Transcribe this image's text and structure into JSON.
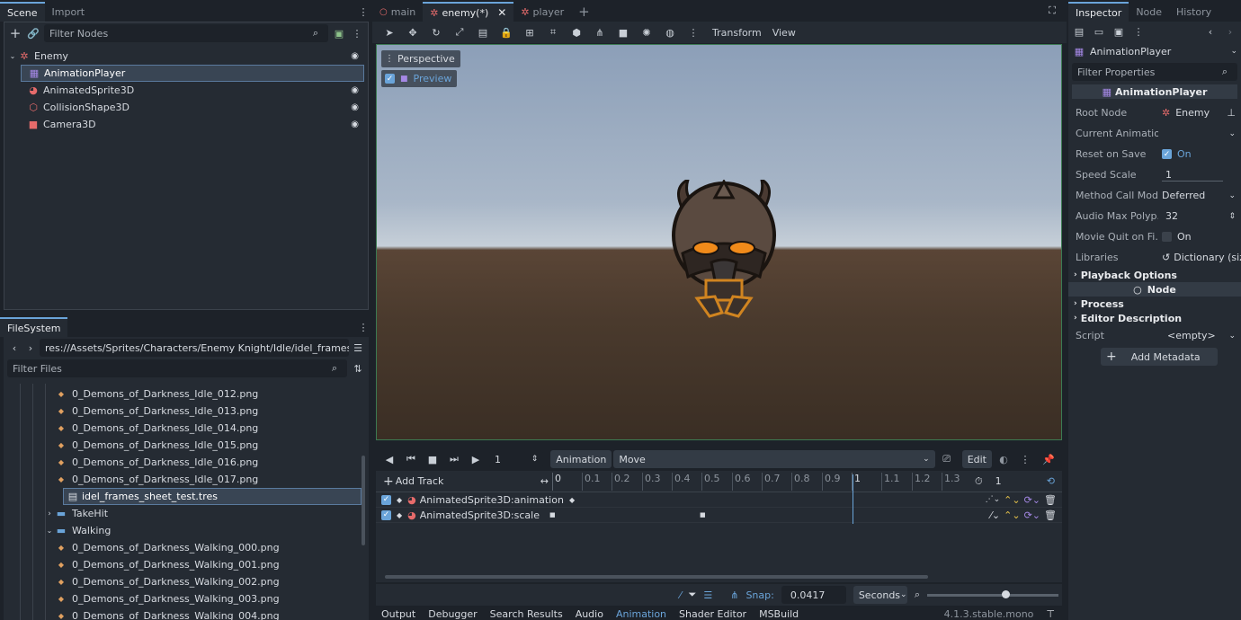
{
  "left_top": {
    "tabs": [
      "Scene",
      "Import"
    ],
    "filter_placeholder": "Filter Nodes",
    "nodes": [
      {
        "label": "Enemy",
        "icon": "node3d-icon"
      },
      {
        "label": "AnimationPlayer",
        "icon": "animation-player-icon"
      },
      {
        "label": "AnimatedSprite3D",
        "icon": "animated-sprite-icon"
      },
      {
        "label": "CollisionShape3D",
        "icon": "collision-shape-icon"
      },
      {
        "label": "Camera3D",
        "icon": "camera-icon"
      }
    ]
  },
  "filesystem": {
    "tab": "FileSystem",
    "path": "res://Assets/Sprites/Characters/Enemy Knight/Idle/idel_frames_sheet_t",
    "filter_placeholder": "Filter Files",
    "items": [
      "0_Demons_of_Darkness_Idle_012.png",
      "0_Demons_of_Darkness_Idle_013.png",
      "0_Demons_of_Darkness_Idle_014.png",
      "0_Demons_of_Darkness_Idle_015.png",
      "0_Demons_of_Darkness_Idle_016.png",
      "0_Demons_of_Darkness_Idle_017.png",
      "idel_frames_sheet_test.tres",
      "TakeHit",
      "Walking",
      "0_Demons_of_Darkness_Walking_000.png",
      "0_Demons_of_Darkness_Walking_001.png",
      "0_Demons_of_Darkness_Walking_002.png",
      "0_Demons_of_Darkness_Walking_003.png",
      "0_Demons_of_Darkness_Walking_004.png"
    ]
  },
  "editor_tabs": [
    "main",
    "enemy(*)",
    "player"
  ],
  "toolbar": {
    "transform": "Transform",
    "view": "View"
  },
  "viewport": {
    "perspective": "Perspective",
    "preview": "Preview"
  },
  "animation": {
    "frame": "1",
    "animation_label": "Animation",
    "current": "Move",
    "edit": "Edit",
    "add_track": "Add Track",
    "ticks": [
      "0",
      "0.1",
      "0.2",
      "0.3",
      "0.4",
      "0.5",
      "0.6",
      "0.7",
      "0.8",
      "0.9",
      "1",
      "1.1",
      "1.2",
      "1.3"
    ],
    "length": "1",
    "tracks": [
      "AnimatedSprite3D:animation",
      "AnimatedSprite3D:scale"
    ],
    "snap_label": "Snap:",
    "snap_value": "0.0417",
    "seconds": "Seconds"
  },
  "bottom_tabs": [
    "Output",
    "Debugger",
    "Search Results",
    "Audio",
    "Animation",
    "Shader Editor",
    "MSBuild"
  ],
  "version": "4.1.3.stable.mono",
  "inspector": {
    "tabs": [
      "Inspector",
      "Node",
      "History"
    ],
    "object": "AnimationPlayer",
    "filter_placeholder": "Filter Properties",
    "header": "AnimationPlayer",
    "props": [
      {
        "label": "Root Node",
        "value": "Enemy"
      },
      {
        "label": "Current Animation",
        "value": ""
      },
      {
        "label": "Reset on Save",
        "value": "On"
      },
      {
        "label": "Speed Scale",
        "value": "1"
      },
      {
        "label": "Method Call Mode",
        "value": "Deferred"
      },
      {
        "label": "Audio Max Polyp...",
        "value": "32"
      },
      {
        "label": "Movie Quit on Fi...",
        "value": "On"
      },
      {
        "label": "Libraries",
        "value": "Dictionary (size"
      }
    ],
    "playback_options": "Playback Options",
    "node_header": "Node",
    "process": "Process",
    "editor_description": "Editor Description",
    "script_label": "Script",
    "script_value": "<empty>",
    "add_metadata": "Add Metadata"
  },
  "colors": {
    "accent": "#6aa4d9",
    "node_red": "#e66b6b",
    "anim_violet": "#a588e6"
  }
}
